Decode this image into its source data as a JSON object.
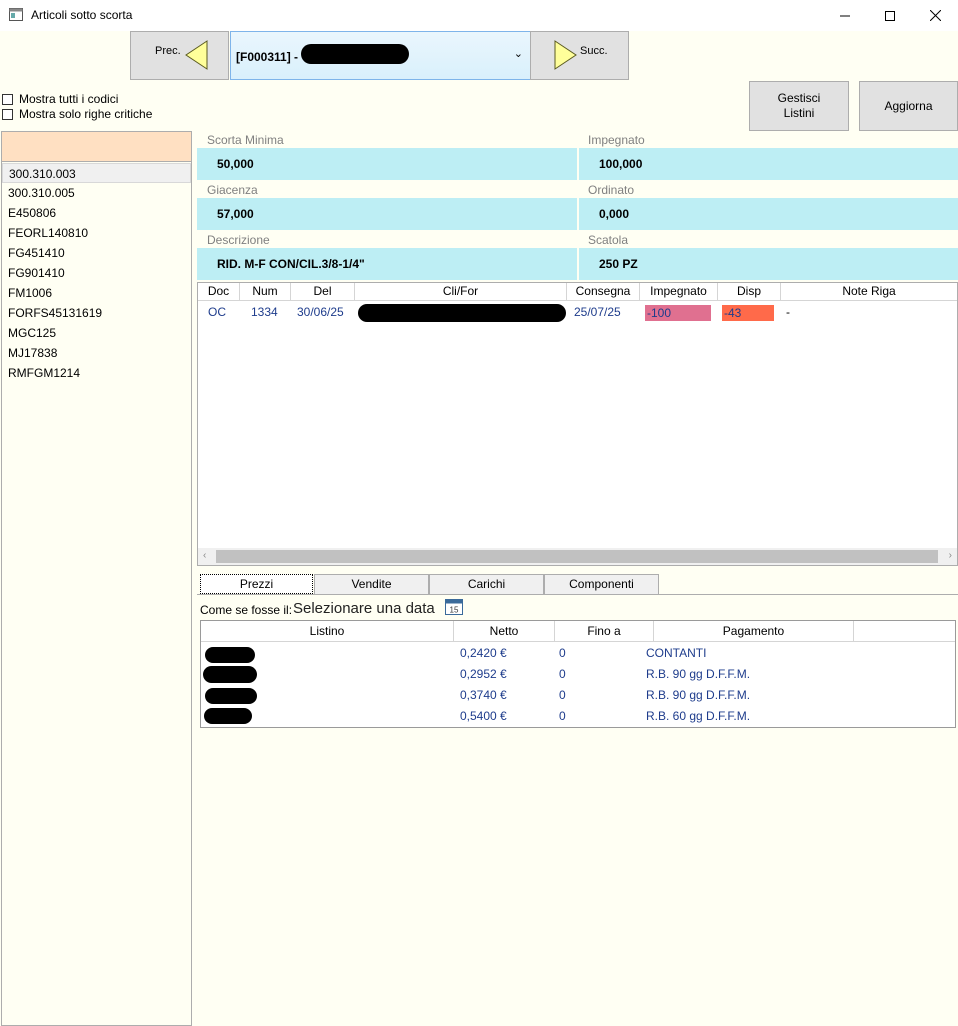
{
  "window": {
    "title": "Articoli sotto scorta"
  },
  "nav": {
    "prev_label": "Prec.",
    "next_label": "Succ.",
    "selected_value": "[F000311] -"
  },
  "options": {
    "show_all_codes": "Mostra tutti i codici",
    "show_critical_only": "Mostra solo righe critiche"
  },
  "buttons": {
    "manage_lists_1": "Gestisci",
    "manage_lists_2": "Listini",
    "refresh": "Aggiorna"
  },
  "codes": [
    "300.310.003",
    "300.310.005",
    "E450806",
    "FEORL140810",
    "FG451410",
    "FG901410",
    "FM1006",
    "FORFS45131619",
    "MGC125",
    "MJ17838",
    "RMFGM1214"
  ],
  "info": {
    "min_stock_label": "Scorta Minima",
    "min_stock_value": "50,000",
    "committed_label": "Impegnato",
    "committed_value": "100,000",
    "stock_label": "Giacenza",
    "stock_value": "57,000",
    "ordered_label": "Ordinato",
    "ordered_value": "0,000",
    "desc_label": "Descrizione",
    "desc_value": "RID. M-F CON/CIL.3/8-1/4\"",
    "box_label": "Scatola",
    "box_value": "250 PZ"
  },
  "orders": {
    "headers": [
      "Doc",
      "Num",
      "Del",
      "Cli/For",
      "Consegna",
      "Impegnato",
      "Disp",
      "Note Riga"
    ],
    "rows": [
      {
        "doc": "OC",
        "num": "1334",
        "date": "30/06/25",
        "delivery": "25/07/25",
        "committed": "-100",
        "avail": "-43",
        "note": "-"
      }
    ]
  },
  "tabs": [
    "Prezzi",
    "Vendite",
    "Carichi",
    "Componenti"
  ],
  "prices": {
    "asof_label": "Come se fosse il:",
    "date_placeholder": "Selezionare una data",
    "calendar_day": "15",
    "headers": [
      "Listino",
      "Netto",
      "Fino a",
      "Pagamento"
    ],
    "rows": [
      {
        "net": "0,2420 €",
        "until": "0",
        "payment": "CONTANTI"
      },
      {
        "net": "0,2952 €",
        "until": "0",
        "payment": "R.B. 90 gg D.F.F.M."
      },
      {
        "net": "0,3740 €",
        "until": "0",
        "payment": "R.B. 90 gg D.F.F.M."
      },
      {
        "net": "0,5400 €",
        "until": "0",
        "payment": "R.B. 60 gg D.F.F.M."
      }
    ]
  },
  "colors": {
    "info_bg": "#bdeef4",
    "committed_cell": "#e07090",
    "avail_cell": "#ff6a4a",
    "filter_bg": "#ffe0c2"
  },
  "icons": [
    "app-icon",
    "minimize-icon",
    "maximize-icon",
    "close-icon",
    "triangle-left-icon",
    "triangle-right-icon",
    "chevron-down-icon",
    "calendar-icon",
    "scroll-left-icon",
    "scroll-right-icon"
  ]
}
